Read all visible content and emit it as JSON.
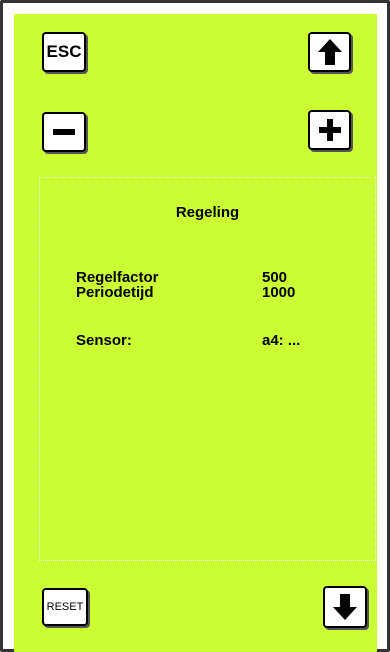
{
  "colors": {
    "background": "#ccff33",
    "frame": "#333333",
    "button_bg": "#ffffff"
  },
  "buttons": {
    "esc_label": "ESC",
    "reset_label": "RESET",
    "up_icon": "arrow-up-icon",
    "down_icon": "arrow-down-icon",
    "minus_icon": "minus-icon",
    "plus_icon": "plus-icon"
  },
  "screen": {
    "title": "Regeling",
    "rows": [
      {
        "label": "Regelfactor",
        "value": "500"
      },
      {
        "label": "Periodetijd",
        "value": "1000"
      },
      {
        "label": "Sensor:",
        "value": "a4: ..."
      }
    ]
  }
}
